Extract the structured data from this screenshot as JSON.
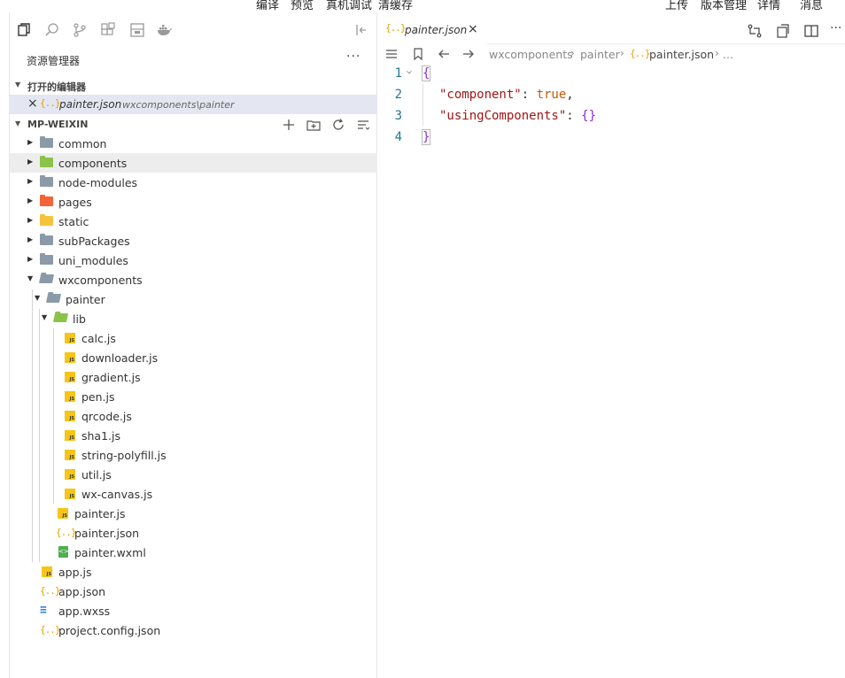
{
  "menu": {
    "items": [
      "编译",
      "预览",
      "真机调试",
      "清缓存"
    ],
    "right_items": [
      "上传",
      "版本管理",
      "详情",
      "消息"
    ]
  },
  "activity_icons": [
    "files-icon",
    "search-icon",
    "source-control-icon",
    "extensions-icon",
    "panel-icon",
    "docker-icon"
  ],
  "explorer": {
    "title": "资源管理器",
    "more": "···",
    "open_editors_label": "打开的编辑器",
    "open_editor": {
      "name": "painter.json",
      "path": "wxcomponents\\painter"
    },
    "project_label": "MP-WEIXIN"
  },
  "tree": [
    {
      "label": "common",
      "type": "folder",
      "color": "#8c9aa8"
    },
    {
      "label": "components",
      "type": "folder",
      "color": "#8bc34a"
    },
    {
      "label": "node-modules",
      "type": "folder",
      "color": "#8c9aa8"
    },
    {
      "label": "pages",
      "type": "folder",
      "color": "#f4623a"
    },
    {
      "label": "static",
      "type": "folder",
      "color": "#f7c33d"
    },
    {
      "label": "subPackages",
      "type": "folder",
      "color": "#8c9aa8"
    },
    {
      "label": "uni_modules",
      "type": "folder",
      "color": "#8c9aa8"
    },
    {
      "label": "wxcomponents",
      "type": "folder-open",
      "color": "#8c9aa8"
    },
    {
      "label": "painter",
      "type": "folder-open",
      "color": "#8c9aa8"
    },
    {
      "label": "lib",
      "type": "folder-open",
      "color": "#8bc34a"
    },
    {
      "label": "calc.js",
      "type": "js"
    },
    {
      "label": "downloader.js",
      "type": "js"
    },
    {
      "label": "gradient.js",
      "type": "js"
    },
    {
      "label": "pen.js",
      "type": "js"
    },
    {
      "label": "qrcode.js",
      "type": "js"
    },
    {
      "label": "sha1.js",
      "type": "js"
    },
    {
      "label": "string-polyfill.js",
      "type": "js"
    },
    {
      "label": "util.js",
      "type": "js"
    },
    {
      "label": "wx-canvas.js",
      "type": "js"
    },
    {
      "label": "painter.js",
      "type": "js"
    },
    {
      "label": "painter.json",
      "type": "json"
    },
    {
      "label": "painter.wxml",
      "type": "wxml"
    },
    {
      "label": "app.js",
      "type": "js"
    },
    {
      "label": "app.json",
      "type": "json"
    },
    {
      "label": "app.wxss",
      "type": "css"
    },
    {
      "label": "project.config.json",
      "type": "json"
    }
  ],
  "editor": {
    "tab_name": "painter.json",
    "breadcrumb": [
      "wxcomponents",
      "painter",
      "painter.json",
      "..."
    ],
    "line_numbers": [
      "1",
      "2",
      "3",
      "4"
    ],
    "code": {
      "open_brace": "{",
      "key1": "\"component\"",
      "colon1": ": ",
      "val1": "true",
      "comma1": ",",
      "key2": "\"usingComponents\"",
      "colon2": ": ",
      "val2": "{}",
      "close_brace": "}"
    }
  },
  "glyphs": {
    "json": "{..}",
    "js": "JS",
    "css": "≡",
    "close": "×"
  }
}
